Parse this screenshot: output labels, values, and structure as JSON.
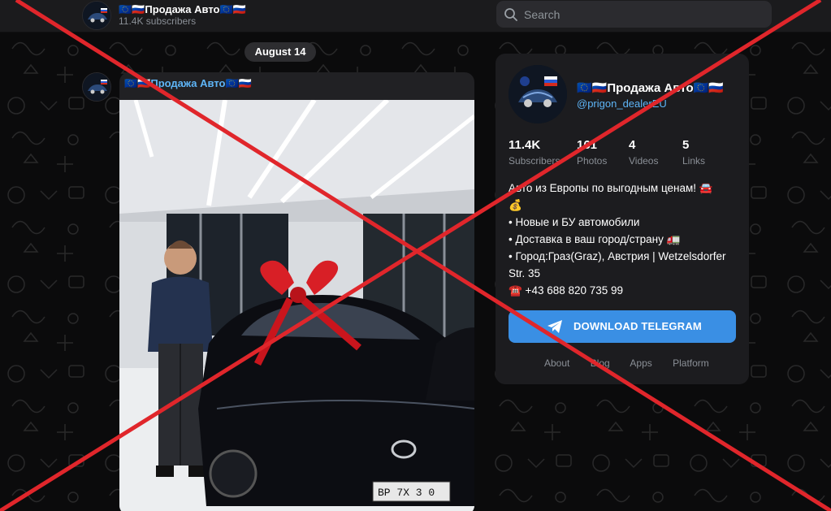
{
  "channel": {
    "name": "🇪🇺🇷🇺Продажа Авто🇪🇺🇷🇺",
    "subscribers_short": "11.4K subscribers",
    "handle": "@prigon_dealerEU"
  },
  "search": {
    "placeholder": "Search"
  },
  "feed": {
    "date": "August 14",
    "post": {
      "author": "🇪🇺🇷🇺Продажа Авто🇪🇺🇷🇺",
      "plate_text": "ВР 7Х 3 0"
    }
  },
  "card": {
    "stats": [
      {
        "value": "11.4K",
        "label": "Subscribers"
      },
      {
        "value": "161",
        "label": "Photos"
      },
      {
        "value": "4",
        "label": "Videos"
      },
      {
        "value": "5",
        "label": "Links"
      }
    ],
    "description": [
      "Авто из Европы по выгодным ценам! 🚘",
      "💰",
      "• Новые и БУ автомобили",
      "• Доставка в ваш город/страну 🚛",
      "• Город:Граз(Graz), Австрия | Wetzelsdorfer",
      "Str. 35",
      "☎️ +43 688 820 735 99"
    ],
    "download_button": "DOWNLOAD TELEGRAM",
    "footer_links": [
      "About",
      "Blog",
      "Apps",
      "Platform"
    ]
  },
  "colors": {
    "accent": "#3a8fe4",
    "link": "#5eb5f7",
    "cross": "#e0262b"
  }
}
